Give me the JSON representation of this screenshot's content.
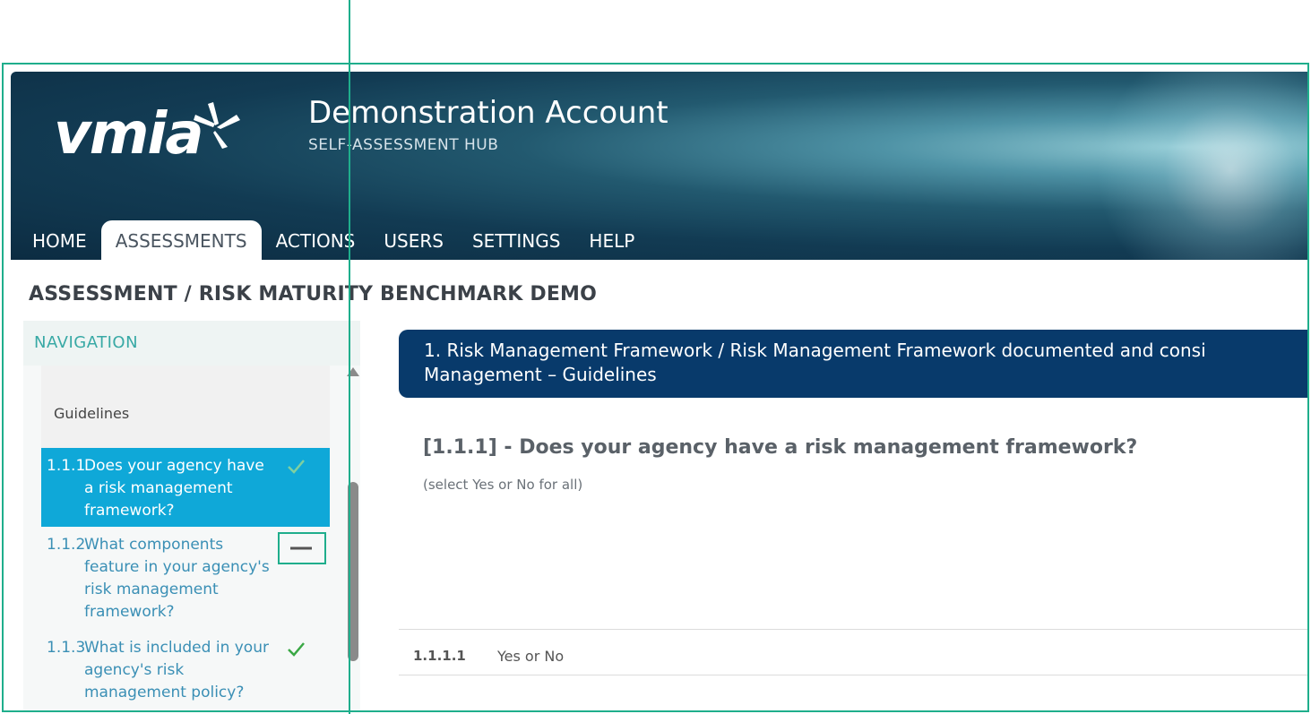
{
  "header": {
    "logo_text": "vmia",
    "account_title": "Demonstration Account",
    "account_subtitle": "SELF-ASSESSMENT HUB"
  },
  "nav": {
    "items": [
      {
        "label": "HOME"
      },
      {
        "label": "ASSESSMENTS",
        "active": true
      },
      {
        "label": "ACTIONS"
      },
      {
        "label": "USERS"
      },
      {
        "label": "SETTINGS"
      },
      {
        "label": "HELP"
      }
    ]
  },
  "breadcrumb": "ASSESSMENT / RISK MATURITY BENCHMARK DEMO",
  "sidebar": {
    "header": "NAVIGATION",
    "group_label": "Guidelines",
    "entries": [
      {
        "num": "1.1.1",
        "text": "Does your agency have a risk management framework?",
        "status": "complete",
        "status_icon": "check-icon"
      },
      {
        "num": "1.1.2",
        "text": "What components feature in your agency's risk management framework?",
        "status": "in-progress",
        "status_icon": "minus-icon"
      },
      {
        "num": "1.1.3",
        "text": "What is included in your agency's risk management policy?",
        "status": "complete",
        "status_icon": "check-icon"
      }
    ]
  },
  "question": {
    "banner_line1": "1. Risk Management Framework / Risk Management Framework documented and consi",
    "banner_line2": "Management – Guidelines",
    "title": "[1.1.1] - Does your agency have a risk management framework?",
    "hint": "(select Yes or No for all)"
  },
  "answers": [
    {
      "num": "1.1.1.1",
      "label": "Yes or No"
    }
  ],
  "colors": {
    "accent": "#1fae8c",
    "active_nav_entry": "#0fa8d8",
    "banner": "#083a6b",
    "check": "#3aa845"
  }
}
